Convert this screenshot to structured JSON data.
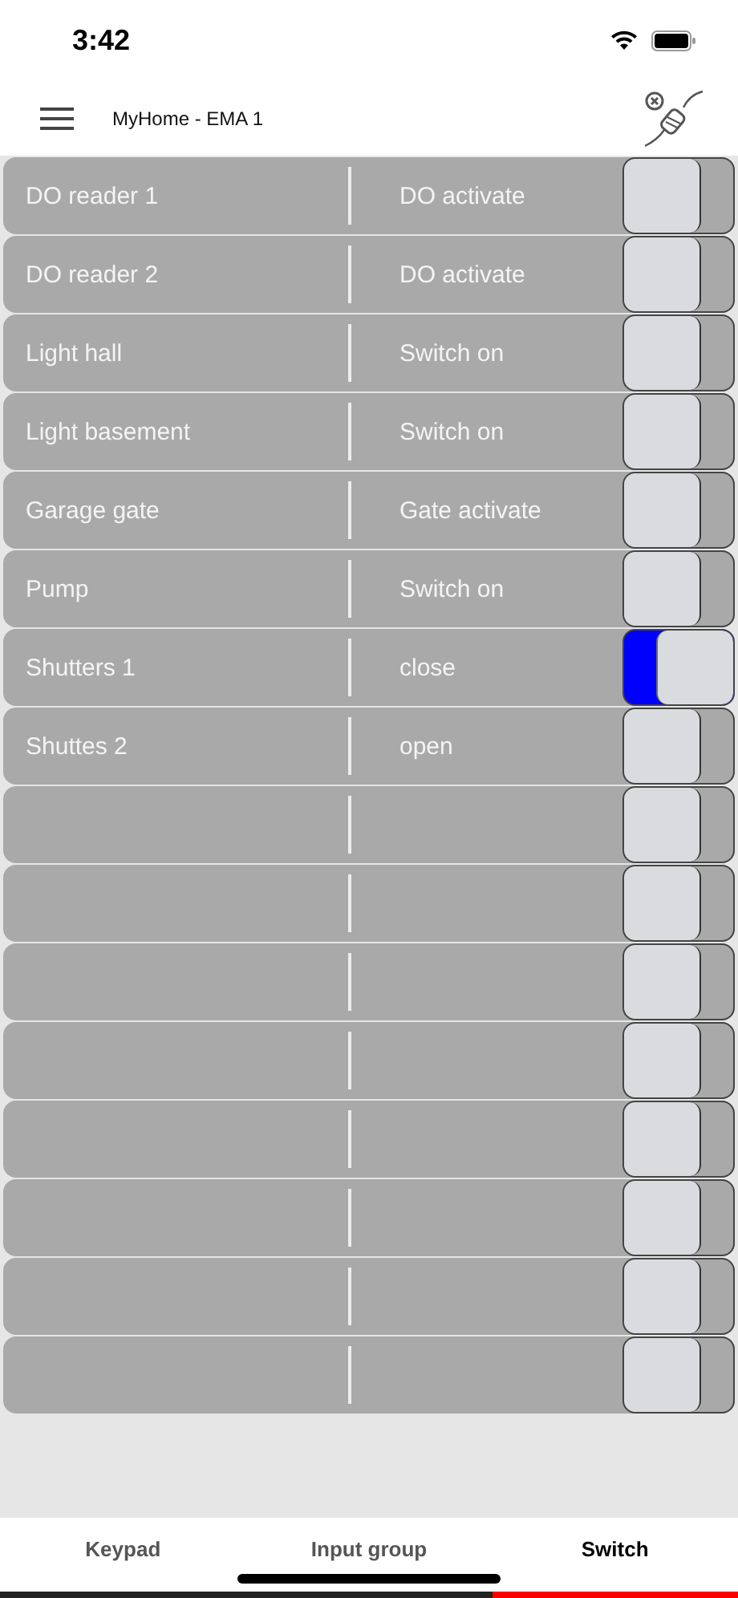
{
  "status_bar": {
    "time": "3:42"
  },
  "header": {
    "title": "MyHome - EMA 1"
  },
  "rows": [
    {
      "name": "DO reader 1",
      "action": "DO activate",
      "on": false
    },
    {
      "name": "DO reader 2",
      "action": "DO activate",
      "on": false
    },
    {
      "name": "Light hall",
      "action": "Switch on",
      "on": false
    },
    {
      "name": "Light basement",
      "action": "Switch on",
      "on": false
    },
    {
      "name": "Garage gate",
      "action": "Gate activate",
      "on": false
    },
    {
      "name": "Pump",
      "action": "Switch on",
      "on": false
    },
    {
      "name": "Shutters 1",
      "action": "close",
      "on": true
    },
    {
      "name": "Shuttes 2",
      "action": "open",
      "on": false
    },
    {
      "on": false
    },
    {
      "on": false
    },
    {
      "on": false
    },
    {
      "on": false
    },
    {
      "on": false
    },
    {
      "on": false
    },
    {
      "on": false
    },
    {
      "on": false
    }
  ],
  "tabs": [
    {
      "label": "Keypad",
      "selected": false
    },
    {
      "label": "Input group",
      "selected": false
    },
    {
      "label": "Switch",
      "selected": true
    }
  ]
}
